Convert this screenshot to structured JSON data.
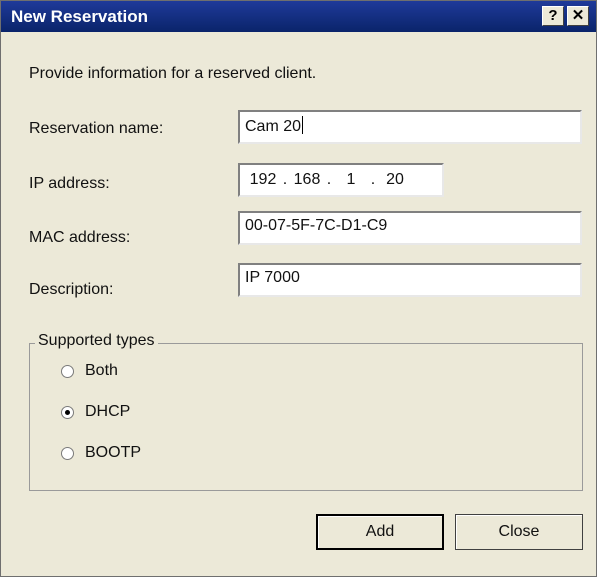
{
  "window": {
    "title": "New Reservation",
    "help_label": "?",
    "close_label": "✕"
  },
  "intro": "Provide information for a reserved client.",
  "fields": {
    "reservation_name": {
      "label": "Reservation name:",
      "value": "Cam 20"
    },
    "ip_address": {
      "label": "IP address:",
      "octets": [
        "192",
        "168",
        "1",
        "20"
      ]
    },
    "mac_address": {
      "label": "MAC address:",
      "value": "00-07-5F-7C-D1-C9"
    },
    "description": {
      "label": "Description:",
      "value": "IP 7000"
    }
  },
  "supported_types": {
    "legend": "Supported types",
    "options": [
      {
        "label": "Both",
        "selected": false
      },
      {
        "label": "DHCP",
        "selected": true
      },
      {
        "label": "BOOTP",
        "selected": false
      }
    ]
  },
  "buttons": {
    "add": "Add",
    "close": "Close"
  }
}
